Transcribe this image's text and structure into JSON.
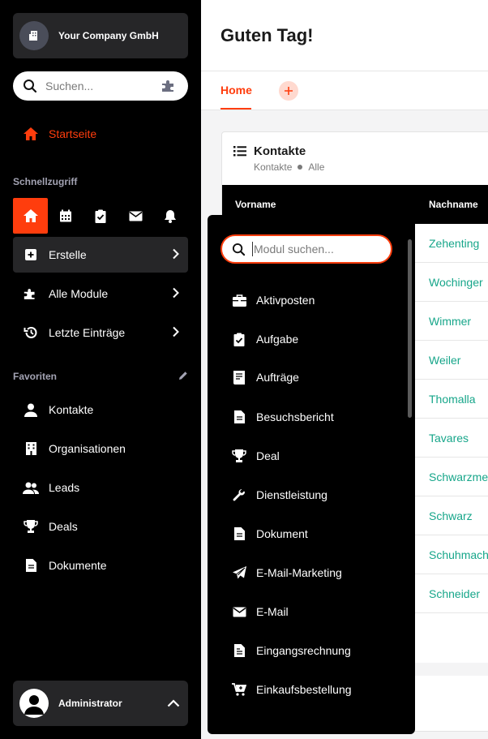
{
  "company": {
    "name": "Your Company GmbH"
  },
  "search": {
    "placeholder": "Suchen..."
  },
  "nav": {
    "home": "Startseite",
    "quick_title": "Schnellzugriff",
    "create": "Erstelle",
    "all_modules": "Alle Module",
    "recent": "Letzte Einträge",
    "favorites_title": "Favoriten",
    "favorites": [
      {
        "label": "Kontakte",
        "icon": "person-icon"
      },
      {
        "label": "Organisationen",
        "icon": "building-icon"
      },
      {
        "label": "Leads",
        "icon": "people-icon"
      },
      {
        "label": "Deals",
        "icon": "trophy-icon"
      },
      {
        "label": "Dokumente",
        "icon": "document-icon"
      }
    ]
  },
  "user": {
    "name": "Administrator"
  },
  "header": {
    "title": "Guten Tag!"
  },
  "tabs": {
    "home": "Home"
  },
  "card": {
    "title": "Kontakte",
    "breadcrumb_1": "Kontakte",
    "breadcrumb_2": "Alle",
    "col_firstname": "Vorname",
    "col_lastname": "Nachname",
    "lastnames": [
      "Zehenting",
      "Wochinger",
      "Wimmer",
      "Weiler",
      "Thomalla",
      "Tavares",
      "Schwarzme",
      "Schwarz",
      "Schuhmach",
      "Schneider"
    ]
  },
  "module_panel": {
    "search_placeholder": "Modul suchen...",
    "items": [
      {
        "label": "Aktivposten",
        "icon": "briefcase-icon"
      },
      {
        "label": "Aufgabe",
        "icon": "clipboard-check-icon"
      },
      {
        "label": "Aufträge",
        "icon": "order-icon"
      },
      {
        "label": "Besuchsbericht",
        "icon": "document-icon"
      },
      {
        "label": "Deal",
        "icon": "trophy-icon"
      },
      {
        "label": "Dienstleistung",
        "icon": "wrench-icon"
      },
      {
        "label": "Dokument",
        "icon": "document-icon"
      },
      {
        "label": "E-Mail-Marketing",
        "icon": "paper-plane-icon"
      },
      {
        "label": "E-Mail",
        "icon": "envelope-icon"
      },
      {
        "label": "Eingangsrechnung",
        "icon": "invoice-icon"
      },
      {
        "label": "Einkaufsbestellung",
        "icon": "cart-icon"
      }
    ]
  },
  "colors": {
    "accent": "#ff3d0d",
    "link": "#17a68a",
    "sidebar": "#000000",
    "panel": "#262628"
  }
}
